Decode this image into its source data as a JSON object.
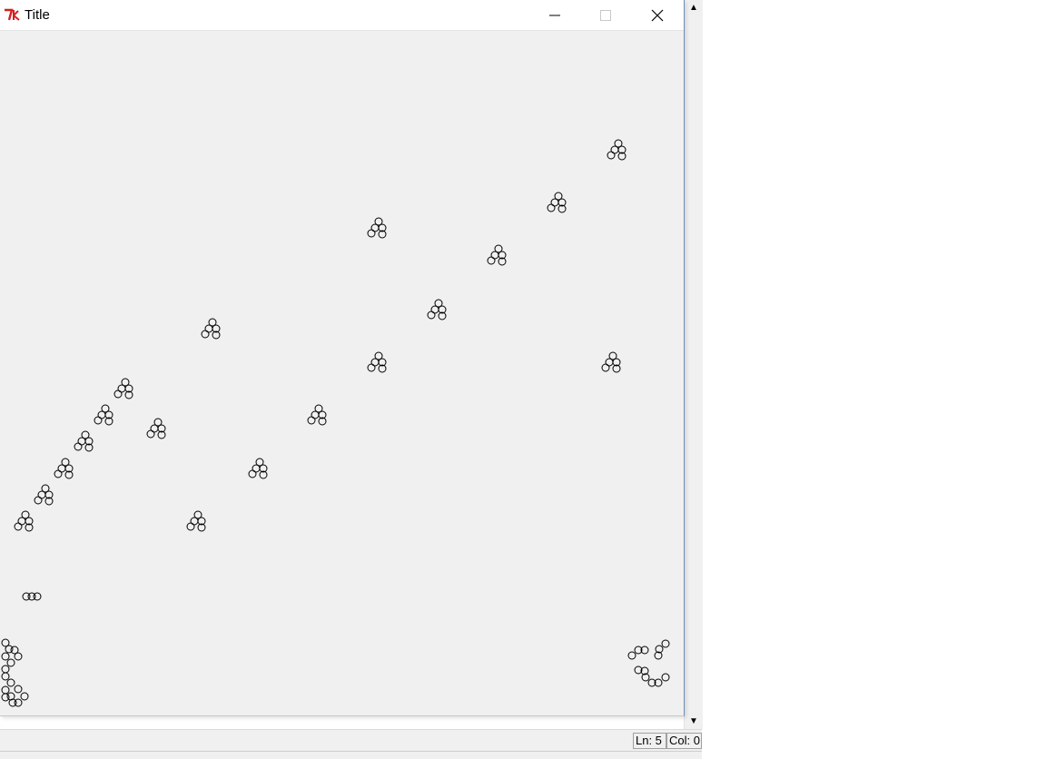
{
  "window": {
    "title": "Title",
    "icon": "tk-feather-icon",
    "controls": [
      "minimize-icon",
      "maximize-icon",
      "close-icon"
    ]
  },
  "background_editor": {
    "status": {
      "line": "Ln: 5",
      "column": "Col: 0"
    }
  },
  "canvas": {
    "background": "#f0f0f0",
    "shape": "circle",
    "outline_color": "#000000",
    "fill": "none",
    "shape_count": 145
  }
}
